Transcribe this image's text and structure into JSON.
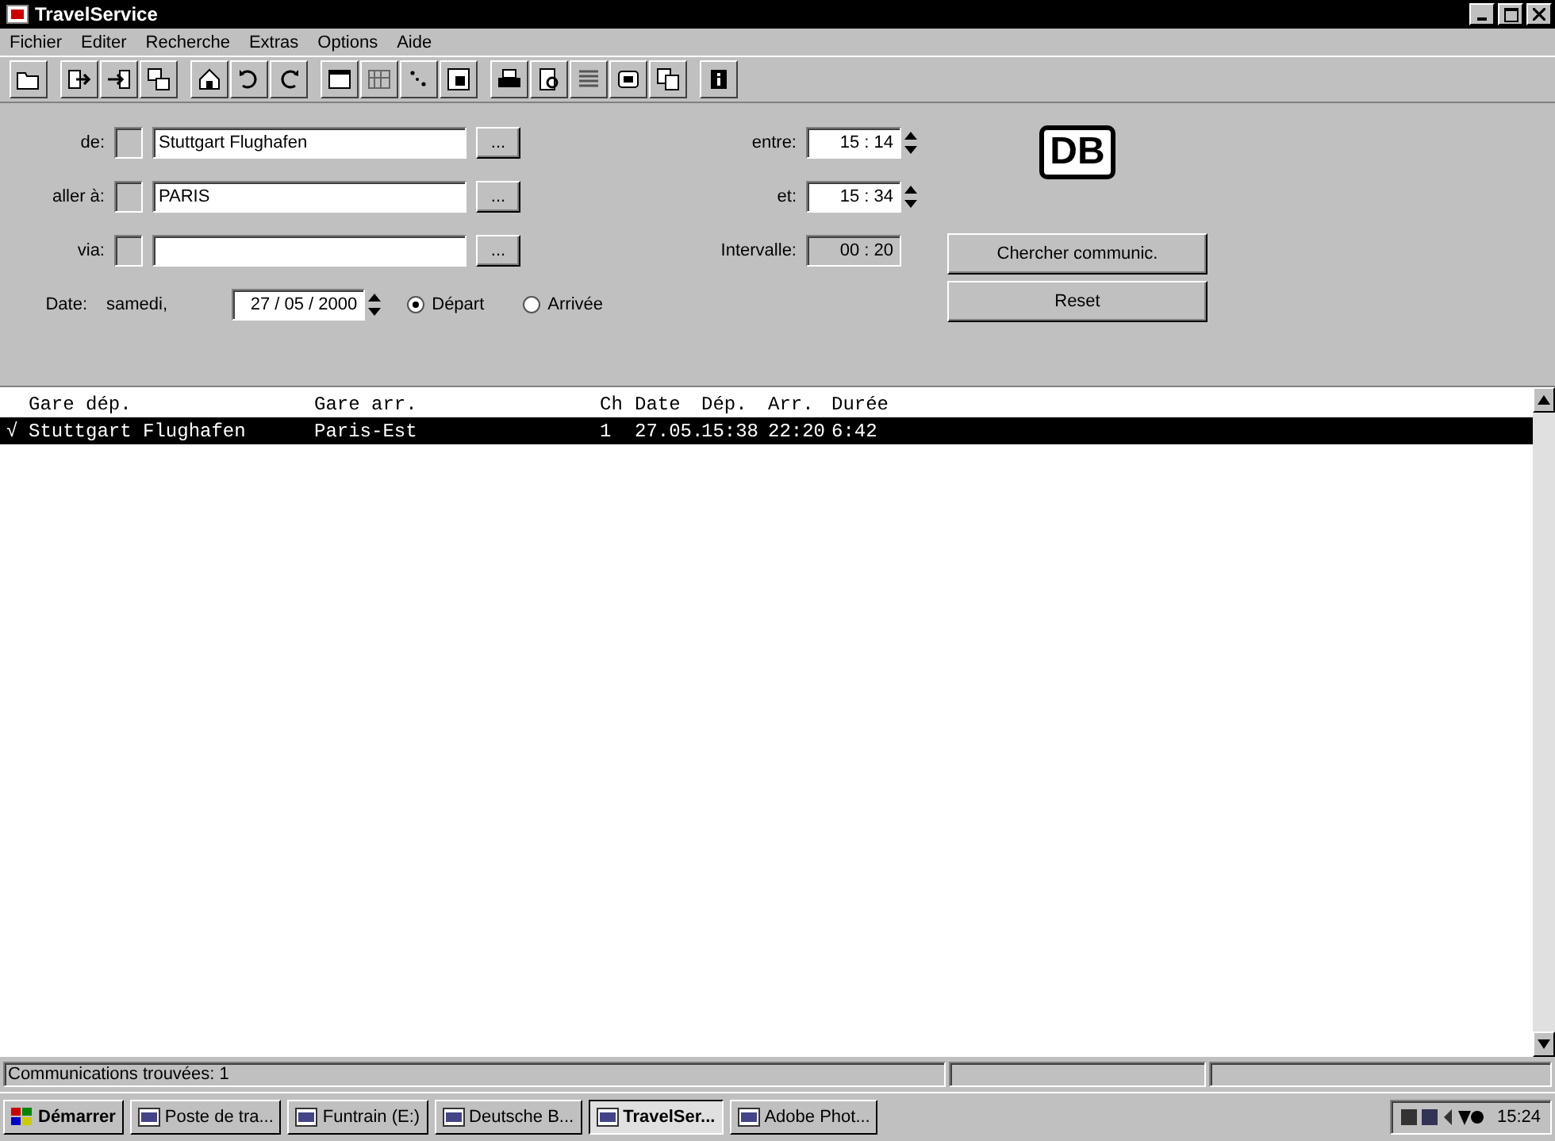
{
  "window": {
    "title": "TravelService"
  },
  "menu": [
    "Fichier",
    "Editer",
    "Recherche",
    "Extras",
    "Options",
    "Aide"
  ],
  "form": {
    "from_label": "de:",
    "from_value": "Stuttgart Flughafen",
    "to_label": "aller à:",
    "to_value": "PARIS",
    "via_label": "via:",
    "browse": "...",
    "between_label": "entre:",
    "between_value": "15 : 14",
    "and_label": "et:",
    "and_value": "15 : 34",
    "interval_label": "Intervalle:",
    "interval_value": "00 : 20",
    "date_label": "Date:",
    "weekday": "samedi,",
    "date_value": "27 / 05 / 2000",
    "radios": [
      {
        "label": "Départ",
        "selected": true
      },
      {
        "label": "Arrivée",
        "selected": false
      }
    ],
    "logo": "DB",
    "search_button": "Chercher communic.",
    "reset_button": "Reset"
  },
  "table": {
    "columns": [
      "Gare dép.",
      "Gare arr.",
      "Ch",
      "Date",
      "Dép.",
      "Arr.",
      "Durée"
    ],
    "rows": [
      {
        "mark": "√",
        "cells": [
          "Stuttgart Flughafen",
          "Paris-Est",
          "1",
          "27.05.",
          "15:38",
          "22:20",
          "6:42"
        ],
        "selected": true
      }
    ]
  },
  "status_bar": "Communications trouvées: 1",
  "taskbar": {
    "start": "Démarrer",
    "items": [
      {
        "label": "Poste de tra...",
        "selected": false
      },
      {
        "label": "Funtrain (E:)",
        "selected": false
      },
      {
        "label": "Deutsche B...",
        "selected": false
      },
      {
        "label": "TravelSer...",
        "selected": true
      },
      {
        "label": "Adobe Phot...",
        "selected": false
      }
    ],
    "clock": "15:24"
  }
}
